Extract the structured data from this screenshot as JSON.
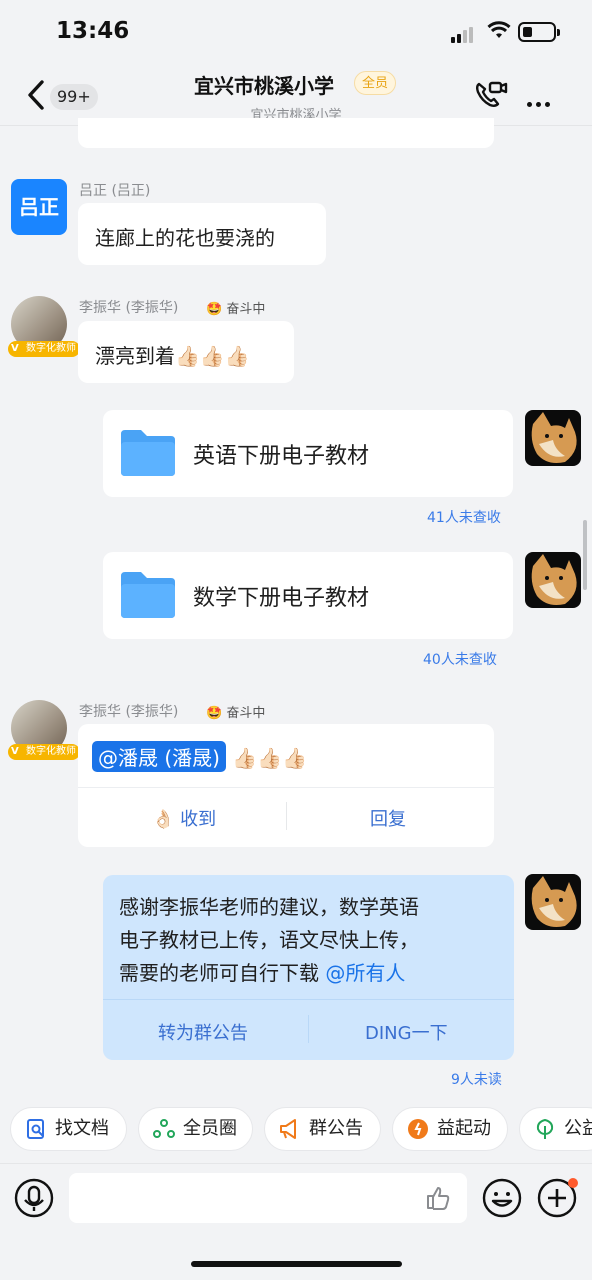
{
  "status_bar": {
    "time": "13:46"
  },
  "header": {
    "unread": "99+",
    "title": "宜兴市桃溪小学",
    "badge": "全员",
    "subtitle": "宜兴市桃溪小学"
  },
  "messages": [
    {
      "sender": "吕正 (吕正)",
      "avatar_text": "吕正",
      "text": "连廊上的花也要浇的"
    },
    {
      "sender": "李振华 (李振华)",
      "status": "🤩 奋斗中",
      "vtag": "数字化教师",
      "text": "漂亮到着👍🏻👍🏻👍🏻"
    },
    {
      "file": "英语下册电子教材",
      "read": "41人未查收"
    },
    {
      "file": "数学下册电子教材",
      "read": "40人未查收"
    },
    {
      "sender": "李振华 (李振华)",
      "status": "🤩 奋斗中",
      "vtag": "数字化教师",
      "mention": "@潘晟 (潘晟)",
      "text_after": "👍🏻👍🏻👍🏻",
      "action_left": "👌🏻 收到",
      "action_right": "回复"
    },
    {
      "lines": [
        "感谢李振华老师的建议，数学英语",
        "电子教材已上传，语文尽快上传，",
        "需要的老师可自行下载 "
      ],
      "mention": "@所有人",
      "action_left": "转为群公告",
      "action_right": "DING一下",
      "read": "9人未读"
    }
  ],
  "toolbar": [
    {
      "label": "找文档",
      "icon": "doc-search-icon"
    },
    {
      "label": "全员圈",
      "icon": "circle-icon"
    },
    {
      "label": "群公告",
      "icon": "megaphone-icon"
    },
    {
      "label": "益起动",
      "icon": "run-icon"
    },
    {
      "label": "公益",
      "icon": "tree-icon"
    }
  ],
  "colors": {
    "accent": "#1a73e8",
    "self_bubble": "#cfe6fd",
    "badge": "#e8a415"
  }
}
